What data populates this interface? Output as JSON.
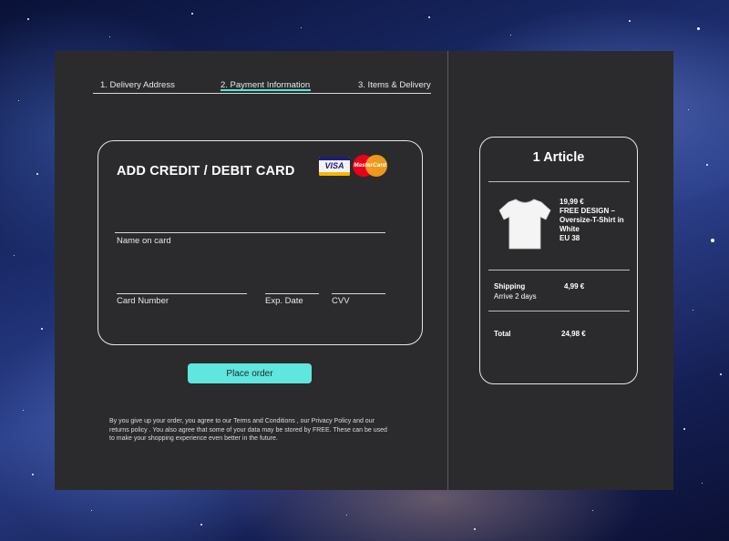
{
  "steps": [
    {
      "label": "1. Delivery Address"
    },
    {
      "label": "2. Payment Information"
    },
    {
      "label": "3. Items & Delivery"
    }
  ],
  "card_form": {
    "title": "ADD CREDIT / DEBIT CARD",
    "visa_label": "VISA",
    "mastercard_label": "MasterCard",
    "name_label": "Name on card",
    "number_label": "Card Number",
    "exp_label": "Exp. Date",
    "cvv_label": "CVV"
  },
  "place_order_label": "Place order",
  "legal_text": "By you give up your order, you agree to our Terms and Conditions , our Privacy Policy and our returns policy . You also agree that some of your data may be stored by FREE. These can be used to make your shopping experience even better in the future.",
  "summary": {
    "title": "1 Article",
    "item": {
      "price": "19,99 €",
      "name": "FREE DESIGN – Oversize-T-Shirt in White",
      "size": "EU 38"
    },
    "shipping": {
      "label": "Shipping",
      "sub": "Arrive 2 days",
      "price": "4,99 €"
    },
    "total": {
      "label": "Total",
      "price": "24,98 €"
    }
  },
  "colors": {
    "accent": "#5fe6de",
    "panel": "#2b2b2d"
  }
}
